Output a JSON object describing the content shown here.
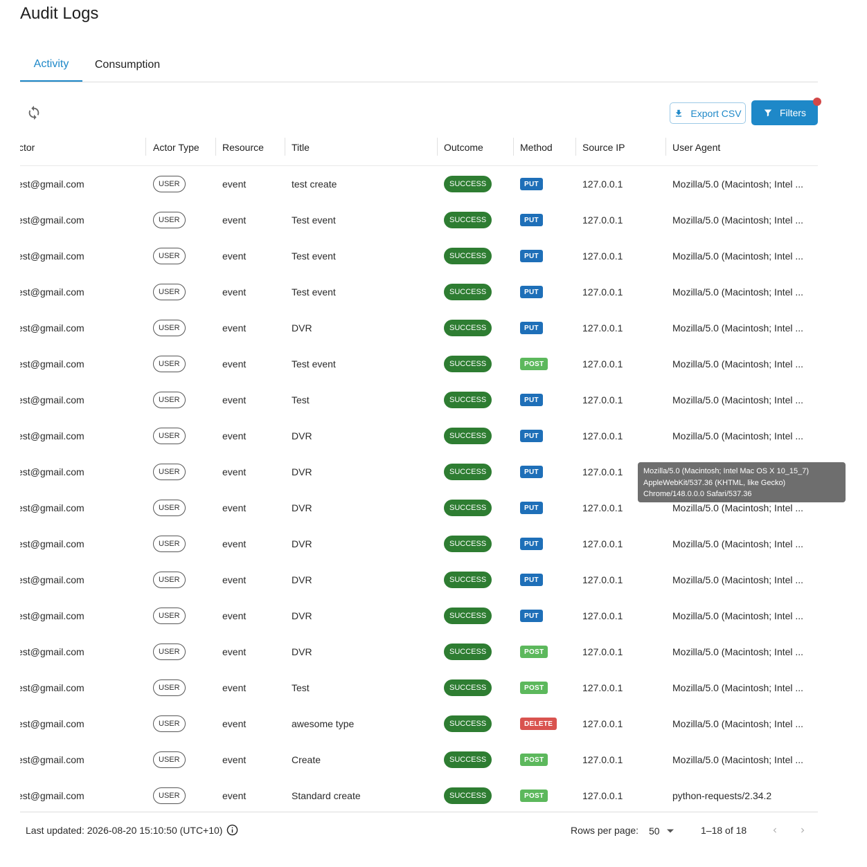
{
  "page": {
    "title": "Audit Logs"
  },
  "tabs": [
    {
      "label": "Activity"
    },
    {
      "label": "Consumption"
    }
  ],
  "toolbar": {
    "export_label": "Export CSV",
    "filters_label": "Filters"
  },
  "table": {
    "columns": [
      "ctor",
      "Actor Type",
      "Resource",
      "Title",
      "Outcome",
      "Method",
      "Source IP",
      "User Agent"
    ],
    "rows": [
      {
        "actor": "est@gmail.com",
        "actor_type": "USER",
        "resource": "event",
        "title": "test create",
        "outcome": "SUCCESS",
        "method": "PUT",
        "ip": "127.0.0.1",
        "ua": "Mozilla/5.0 (Macintosh; Intel ..."
      },
      {
        "actor": "est@gmail.com",
        "actor_type": "USER",
        "resource": "event",
        "title": "Test event",
        "outcome": "SUCCESS",
        "method": "PUT",
        "ip": "127.0.0.1",
        "ua": "Mozilla/5.0 (Macintosh; Intel ..."
      },
      {
        "actor": "est@gmail.com",
        "actor_type": "USER",
        "resource": "event",
        "title": "Test event",
        "outcome": "SUCCESS",
        "method": "PUT",
        "ip": "127.0.0.1",
        "ua": "Mozilla/5.0 (Macintosh; Intel ..."
      },
      {
        "actor": "est@gmail.com",
        "actor_type": "USER",
        "resource": "event",
        "title": "Test event",
        "outcome": "SUCCESS",
        "method": "PUT",
        "ip": "127.0.0.1",
        "ua": "Mozilla/5.0 (Macintosh; Intel ..."
      },
      {
        "actor": "est@gmail.com",
        "actor_type": "USER",
        "resource": "event",
        "title": "DVR",
        "outcome": "SUCCESS",
        "method": "PUT",
        "ip": "127.0.0.1",
        "ua": "Mozilla/5.0 (Macintosh; Intel ..."
      },
      {
        "actor": "est@gmail.com",
        "actor_type": "USER",
        "resource": "event",
        "title": "Test event",
        "outcome": "SUCCESS",
        "method": "POST",
        "ip": "127.0.0.1",
        "ua": "Mozilla/5.0 (Macintosh; Intel ..."
      },
      {
        "actor": "est@gmail.com",
        "actor_type": "USER",
        "resource": "event",
        "title": "Test",
        "outcome": "SUCCESS",
        "method": "PUT",
        "ip": "127.0.0.1",
        "ua": "Mozilla/5.0 (Macintosh; Intel ..."
      },
      {
        "actor": "est@gmail.com",
        "actor_type": "USER",
        "resource": "event",
        "title": "DVR",
        "outcome": "SUCCESS",
        "method": "PUT",
        "ip": "127.0.0.1",
        "ua": "Mozilla/5.0 (Macintosh; Intel ..."
      },
      {
        "actor": "est@gmail.com",
        "actor_type": "USER",
        "resource": "event",
        "title": "DVR",
        "outcome": "SUCCESS",
        "method": "PUT",
        "ip": "127.0.0.1",
        "ua": ""
      },
      {
        "actor": "est@gmail.com",
        "actor_type": "USER",
        "resource": "event",
        "title": "DVR",
        "outcome": "SUCCESS",
        "method": "PUT",
        "ip": "127.0.0.1",
        "ua": "Mozilla/5.0 (Macintosh; Intel ..."
      },
      {
        "actor": "est@gmail.com",
        "actor_type": "USER",
        "resource": "event",
        "title": "DVR",
        "outcome": "SUCCESS",
        "method": "PUT",
        "ip": "127.0.0.1",
        "ua": "Mozilla/5.0 (Macintosh; Intel ..."
      },
      {
        "actor": "est@gmail.com",
        "actor_type": "USER",
        "resource": "event",
        "title": "DVR",
        "outcome": "SUCCESS",
        "method": "PUT",
        "ip": "127.0.0.1",
        "ua": "Mozilla/5.0 (Macintosh; Intel ..."
      },
      {
        "actor": "est@gmail.com",
        "actor_type": "USER",
        "resource": "event",
        "title": "DVR",
        "outcome": "SUCCESS",
        "method": "PUT",
        "ip": "127.0.0.1",
        "ua": "Mozilla/5.0 (Macintosh; Intel ..."
      },
      {
        "actor": "est@gmail.com",
        "actor_type": "USER",
        "resource": "event",
        "title": "DVR",
        "outcome": "SUCCESS",
        "method": "POST",
        "ip": "127.0.0.1",
        "ua": "Mozilla/5.0 (Macintosh; Intel ..."
      },
      {
        "actor": "est@gmail.com",
        "actor_type": "USER",
        "resource": "event",
        "title": "Test",
        "outcome": "SUCCESS",
        "method": "POST",
        "ip": "127.0.0.1",
        "ua": "Mozilla/5.0 (Macintosh; Intel ..."
      },
      {
        "actor": "est@gmail.com",
        "actor_type": "USER",
        "resource": "event",
        "title": "awesome type",
        "outcome": "SUCCESS",
        "method": "DELETE",
        "ip": "127.0.0.1",
        "ua": "Mozilla/5.0 (Macintosh; Intel ..."
      },
      {
        "actor": "est@gmail.com",
        "actor_type": "USER",
        "resource": "event",
        "title": "Create",
        "outcome": "SUCCESS",
        "method": "POST",
        "ip": "127.0.0.1",
        "ua": "Mozilla/5.0 (Macintosh; Intel ..."
      },
      {
        "actor": "est@gmail.com",
        "actor_type": "USER",
        "resource": "event",
        "title": "Standard create",
        "outcome": "SUCCESS",
        "method": "POST",
        "ip": "127.0.0.1",
        "ua": "python-requests/2.34.2"
      }
    ]
  },
  "method_colors": {
    "PUT": "#1e6fb8",
    "POST": "#5cb85c",
    "DELETE": "#d9534f"
  },
  "tooltip": {
    "lines": [
      "Mozilla/5.0 (Macintosh; Intel Mac OS X 10_15_7)",
      "AppleWebKit/537.36 (KHTML, like Gecko)",
      "Chrome/148.0.0.0 Safari/537.36"
    ]
  },
  "footer": {
    "last_updated": "Last updated: 2026-08-20 15:10:50 (UTC+10)",
    "rows_per_page_label": "Rows per page:",
    "rows_per_page_value": "50",
    "page_range": "1–18 of 18"
  },
  "icons": {
    "refresh": "refresh-icon",
    "export": "download-icon",
    "filters": "filter-icon",
    "info": "info-icon",
    "dropdown": "caret-down-icon",
    "prev": "chevron-left-icon",
    "next": "chevron-right-icon"
  },
  "colors": {
    "accent": "#1e88c8",
    "success": "#2e7d32",
    "badge_dot": "#d24848"
  }
}
